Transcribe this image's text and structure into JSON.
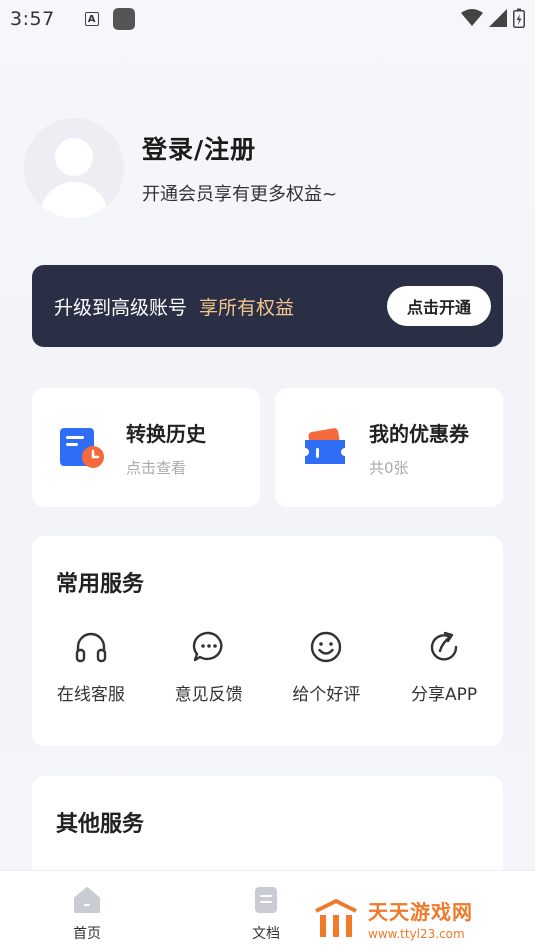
{
  "status_bar": {
    "time": "3:57",
    "a_badge": "A"
  },
  "profile": {
    "title": "登录/注册",
    "subtitle": "开通会员享有更多权益~"
  },
  "vip_banner": {
    "text": "升级到高级账号",
    "accent": "享所有权益",
    "button": "点击开通"
  },
  "quick_cards": [
    {
      "title": "转换历史",
      "subtitle": "点击查看",
      "icon": "history-document-icon"
    },
    {
      "title": "我的优惠券",
      "subtitle": "共0张",
      "icon": "coupon-wallet-icon"
    }
  ],
  "common_services": {
    "title": "常用服务",
    "items": [
      {
        "label": "在线客服",
        "icon": "headphones-icon"
      },
      {
        "label": "意见反馈",
        "icon": "chat-bubble-icon"
      },
      {
        "label": "给个好评",
        "icon": "smile-icon"
      },
      {
        "label": "分享APP",
        "icon": "share-icon"
      }
    ]
  },
  "other_services": {
    "title": "其他服务"
  },
  "tabbar": {
    "home": "首页",
    "docs": "文档"
  },
  "watermark": {
    "name": "天天游戏网",
    "url": "www.ttyl23.com"
  },
  "colors": {
    "banner_bg": "#2b2f45",
    "banner_accent": "#f2c58f",
    "icon_blue": "#2f6df6",
    "icon_orange": "#f56a3c"
  }
}
